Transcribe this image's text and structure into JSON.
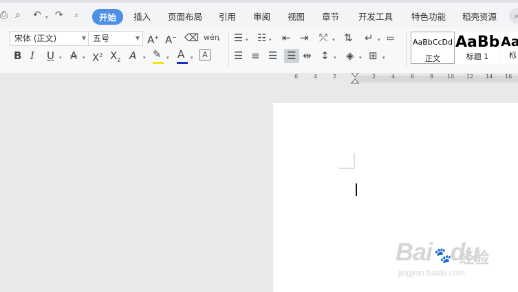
{
  "menubar": {
    "tabs": [
      {
        "label": "开始",
        "active": true
      },
      {
        "label": "插入"
      },
      {
        "label": "页面布局"
      },
      {
        "label": "引用"
      },
      {
        "label": "审阅"
      },
      {
        "label": "视图"
      },
      {
        "label": "章节"
      },
      {
        "label": "开发工具"
      },
      {
        "label": "特色功能"
      },
      {
        "label": "稻壳资源"
      }
    ]
  },
  "ribbon": {
    "font_name": "宋体 (正文)",
    "font_size": "五号",
    "text_glyphs": {
      "bold": "B",
      "italic": "I",
      "underline": "U",
      "font_color": "A",
      "char_border": "A",
      "grow_font": "A",
      "shrink_font": "A",
      "phonetic": "wén"
    },
    "styles": [
      {
        "sample": "AaBbCcDd",
        "label": "正文"
      },
      {
        "sample": "AaBb",
        "label": "标题 1"
      },
      {
        "sample": "Aa",
        "label": "标"
      }
    ]
  },
  "ruler": {
    "labels": [
      "6",
      "4",
      "2",
      "2",
      "4",
      "6",
      "8",
      "10",
      "12",
      "14",
      "16"
    ]
  },
  "watermark": {
    "brand": "Bai",
    "brand2": "du",
    "cn": "经验",
    "url": "jingyan.baidu.com"
  },
  "colors": {
    "accent": "#4e8fe8",
    "font_color_bar": "#1a2ecc",
    "highlight_bar": "#f2e600"
  }
}
